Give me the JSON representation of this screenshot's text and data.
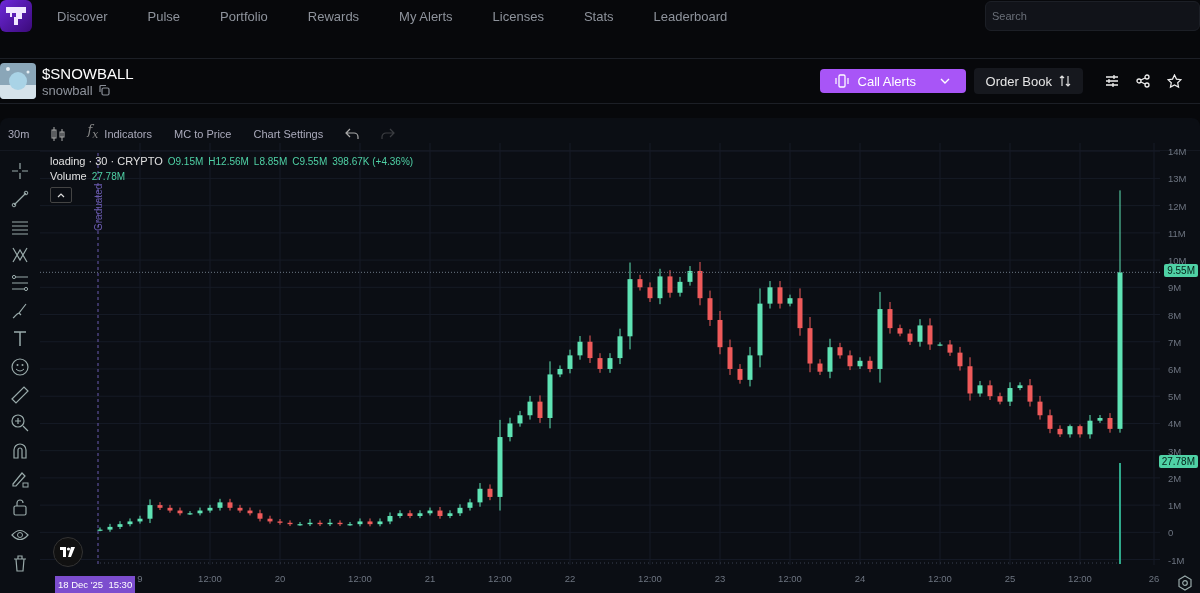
{
  "nav": {
    "items": [
      {
        "label": "Discover",
        "selected": false
      },
      {
        "label": "Pulse",
        "selected": false
      },
      {
        "label": "Portfolio",
        "selected": false
      },
      {
        "label": "Rewards",
        "selected": false
      },
      {
        "label": "My Alerts",
        "selected": false
      },
      {
        "label": "Licenses",
        "selected": false
      },
      {
        "label": "Stats",
        "selected": false
      },
      {
        "label": "Leaderboard",
        "selected": false
      }
    ],
    "search": {
      "placeholder": "Search"
    }
  },
  "token": {
    "symbol": "$SNOWBALL",
    "name": "snowball"
  },
  "actions": {
    "call_alerts": "Call Alerts",
    "order_book": "Order Book"
  },
  "toolbar": {
    "interval": "30m",
    "indicators_glyph": "f$_{x}$",
    "indicators": "Indicators",
    "mc_to_price": "MC to Price",
    "chart_settings": "Chart Settings",
    "undo": {
      "disabled": false
    },
    "redo": {
      "disabled": true
    }
  },
  "legend": {
    "title": "loading · 30 · CRYPTO",
    "ohlc": [
      "O9.15M",
      "H12.56M",
      "L8.85M",
      "C9.55M",
      "398.67K (+4.36%)"
    ],
    "volume_label": "Volume",
    "volume_value": "27.78M"
  },
  "graduated_label": "Graduated",
  "price_badge": "9.55M",
  "volume_badge": "27.78M",
  "date_badge": "18 Dec '25  15:30",
  "axis_tail_label": "26",
  "chart_data": {
    "type": "candlestick",
    "grid": true,
    "ylim": [
      -1.2,
      14.3
    ],
    "yticks": [
      {
        "value": -1,
        "label": "-1M"
      },
      {
        "value": 0,
        "label": "0"
      },
      {
        "value": 1,
        "label": "1M"
      },
      {
        "value": 2,
        "label": "2M"
      },
      {
        "value": 3,
        "label": "3M"
      },
      {
        "value": 4,
        "label": "4M"
      },
      {
        "value": 5,
        "label": "5M"
      },
      {
        "value": 6,
        "label": "6M"
      },
      {
        "value": 7,
        "label": "7M"
      },
      {
        "value": 8,
        "label": "8M"
      },
      {
        "value": 9,
        "label": "9M"
      },
      {
        "value": 10,
        "label": "10M"
      },
      {
        "value": 11,
        "label": "11M"
      },
      {
        "value": 12,
        "label": "12M"
      },
      {
        "value": 13,
        "label": "13M"
      },
      {
        "value": 14,
        "label": "14M"
      }
    ],
    "categories": [
      null,
      null,
      null,
      null,
      "9",
      null,
      null,
      null,
      null,
      null,
      null,
      "12:00",
      null,
      null,
      null,
      null,
      null,
      null,
      "20",
      null,
      null,
      null,
      null,
      null,
      null,
      null,
      "12:00",
      null,
      null,
      null,
      null,
      null,
      null,
      "21",
      null,
      null,
      null,
      null,
      null,
      null,
      "12:00",
      null,
      null,
      null,
      null,
      null,
      null,
      "22",
      null,
      null,
      null,
      null,
      null,
      null,
      null,
      "12:00",
      null,
      null,
      null,
      null,
      null,
      null,
      "23",
      null,
      null,
      null,
      null,
      null,
      null,
      "12:00",
      null,
      null,
      null,
      null,
      null,
      null,
      "24",
      null,
      null,
      null,
      null,
      null,
      null,
      null,
      "12:00",
      null,
      null,
      null,
      null,
      null,
      null,
      "25",
      null,
      null,
      null,
      null,
      null,
      null,
      "12:00",
      null,
      null,
      null,
      null
    ],
    "ohlc": [
      [
        0.1,
        0.18,
        0.04,
        0.1
      ],
      [
        0.1,
        0.31,
        0.02,
        0.2
      ],
      [
        0.2,
        0.41,
        0.12,
        0.3
      ],
      [
        0.3,
        0.51,
        0.22,
        0.4
      ],
      [
        0.4,
        0.61,
        0.32,
        0.5
      ],
      [
        0.5,
        1.21,
        0.34,
        1.0
      ],
      [
        1.0,
        1.11,
        0.82,
        0.9
      ],
      [
        0.9,
        1.01,
        0.72,
        0.8
      ],
      [
        0.8,
        0.91,
        0.62,
        0.7
      ],
      [
        0.7,
        0.78,
        0.64,
        0.7
      ],
      [
        0.7,
        0.91,
        0.62,
        0.8
      ],
      [
        0.8,
        1.01,
        0.72,
        0.9
      ],
      [
        0.9,
        1.23,
        0.8,
        1.1
      ],
      [
        1.1,
        1.23,
        0.8,
        0.9
      ],
      [
        0.9,
        1.01,
        0.72,
        0.8
      ],
      [
        0.8,
        0.91,
        0.62,
        0.7
      ],
      [
        0.7,
        0.83,
        0.4,
        0.5
      ],
      [
        0.5,
        0.61,
        0.32,
        0.4
      ],
      [
        0.4,
        0.49,
        0.28,
        0.35
      ],
      [
        0.35,
        0.44,
        0.23,
        0.3
      ],
      [
        0.3,
        0.38,
        0.24,
        0.3
      ],
      [
        0.3,
        0.49,
        0.23,
        0.35
      ],
      [
        0.35,
        0.44,
        0.23,
        0.3
      ],
      [
        0.3,
        0.49,
        0.23,
        0.35
      ],
      [
        0.35,
        0.44,
        0.23,
        0.3
      ],
      [
        0.3,
        0.38,
        0.24,
        0.3
      ],
      [
        0.3,
        0.51,
        0.22,
        0.4
      ],
      [
        0.4,
        0.51,
        0.22,
        0.3
      ],
      [
        0.3,
        0.51,
        0.22,
        0.4
      ],
      [
        0.4,
        0.73,
        0.3,
        0.6
      ],
      [
        0.6,
        0.81,
        0.52,
        0.7
      ],
      [
        0.7,
        0.81,
        0.52,
        0.6
      ],
      [
        0.6,
        0.81,
        0.52,
        0.7
      ],
      [
        0.7,
        0.91,
        0.62,
        0.8
      ],
      [
        0.8,
        0.93,
        0.5,
        0.6
      ],
      [
        0.6,
        0.81,
        0.52,
        0.7
      ],
      [
        0.7,
        1.03,
        0.6,
        0.9
      ],
      [
        0.9,
        1.23,
        0.8,
        1.1
      ],
      [
        1.1,
        1.81,
        0.94,
        1.6
      ],
      [
        1.6,
        1.76,
        1.18,
        1.3
      ],
      [
        1.3,
        4.13,
        0.8,
        3.5
      ],
      [
        3.5,
        4.21,
        3.34,
        4.0
      ],
      [
        4.0,
        4.46,
        3.88,
        4.3
      ],
      [
        4.3,
        5.01,
        4.14,
        4.8
      ],
      [
        4.8,
        5.03,
        4.02,
        4.2
      ],
      [
        4.2,
        6.28,
        3.82,
        5.8
      ],
      [
        5.8,
        6.13,
        5.7,
        6.0
      ],
      [
        6.0,
        6.71,
        5.84,
        6.5
      ],
      [
        6.5,
        7.21,
        6.34,
        7.0
      ],
      [
        7.0,
        7.23,
        6.22,
        6.4
      ],
      [
        6.4,
        6.58,
        5.86,
        6.0
      ],
      [
        6.0,
        6.58,
        5.86,
        6.4
      ],
      [
        6.4,
        7.48,
        6.18,
        7.2
      ],
      [
        7.2,
        9.91,
        6.72,
        9.3
      ],
      [
        9.3,
        9.46,
        8.88,
        9.0
      ],
      [
        9.0,
        9.18,
        8.46,
        8.6
      ],
      [
        8.6,
        9.68,
        8.38,
        9.4
      ],
      [
        9.4,
        9.63,
        8.62,
        8.8
      ],
      [
        8.8,
        9.38,
        8.66,
        9.2
      ],
      [
        9.2,
        9.78,
        9.06,
        9.6
      ],
      [
        9.6,
        9.93,
        8.34,
        8.6
      ],
      [
        8.6,
        8.88,
        7.58,
        7.8
      ],
      [
        7.8,
        8.13,
        6.54,
        6.8
      ],
      [
        6.8,
        7.08,
        5.78,
        6.0
      ],
      [
        6.0,
        6.18,
        5.46,
        5.6
      ],
      [
        5.6,
        6.81,
        5.36,
        6.5
      ],
      [
        6.5,
        8.96,
        6.06,
        8.4
      ],
      [
        8.4,
        9.23,
        8.22,
        9.0
      ],
      [
        9.0,
        9.23,
        8.22,
        8.4
      ],
      [
        8.4,
        8.73,
        8.3,
        8.6
      ],
      [
        8.6,
        8.96,
        7.22,
        7.5
      ],
      [
        7.5,
        7.91,
        5.88,
        6.2
      ],
      [
        6.2,
        6.36,
        5.78,
        5.9
      ],
      [
        5.9,
        7.11,
        5.66,
        6.8
      ],
      [
        6.8,
        6.96,
        6.38,
        6.5
      ],
      [
        6.5,
        6.68,
        5.96,
        6.1
      ],
      [
        6.1,
        6.43,
        6.0,
        6.3
      ],
      [
        6.3,
        6.46,
        5.88,
        6.0
      ],
      [
        6.0,
        8.83,
        5.5,
        8.2
      ],
      [
        8.2,
        8.46,
        7.3,
        7.5
      ],
      [
        7.5,
        7.63,
        7.2,
        7.3
      ],
      [
        7.3,
        7.46,
        6.88,
        7.0
      ],
      [
        7.0,
        7.83,
        6.82,
        7.6
      ],
      [
        7.6,
        7.86,
        6.7,
        6.9
      ],
      [
        6.9,
        6.98,
        6.84,
        6.9
      ],
      [
        6.9,
        7.06,
        6.48,
        6.6
      ],
      [
        6.6,
        6.81,
        5.94,
        6.1
      ],
      [
        6.1,
        6.43,
        4.84,
        5.1
      ],
      [
        5.1,
        5.56,
        4.98,
        5.4
      ],
      [
        5.4,
        5.58,
        4.86,
        5.0
      ],
      [
        5.0,
        5.13,
        4.7,
        4.8
      ],
      [
        4.8,
        5.51,
        4.64,
        5.3
      ],
      [
        5.3,
        5.51,
        5.22,
        5.4
      ],
      [
        5.4,
        5.63,
        4.62,
        4.8
      ],
      [
        4.8,
        5.01,
        4.14,
        4.3
      ],
      [
        4.3,
        4.51,
        3.64,
        3.8
      ],
      [
        3.8,
        3.93,
        3.5,
        3.6
      ],
      [
        3.6,
        3.96,
        3.48,
        3.9
      ],
      [
        3.9,
        3.96,
        3.48,
        3.6
      ],
      [
        3.6,
        4.31,
        3.44,
        4.1
      ],
      [
        4.1,
        4.31,
        4.02,
        4.2
      ],
      [
        4.2,
        4.38,
        3.66,
        3.8
      ],
      [
        3.8,
        12.56,
        3.66,
        9.55
      ]
    ]
  }
}
